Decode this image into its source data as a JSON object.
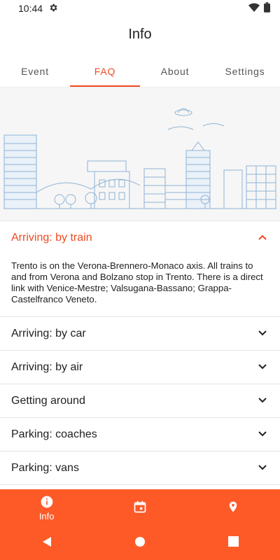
{
  "status_bar": {
    "time": "10:44",
    "icons": [
      "gear-icon",
      "wifi-icon",
      "battery-icon"
    ]
  },
  "app_title": "Info",
  "tabs": [
    {
      "label": "Event",
      "active": false
    },
    {
      "label": "FAQ",
      "active": true
    },
    {
      "label": "About",
      "active": false
    },
    {
      "label": "Settings",
      "active": false
    }
  ],
  "colors": {
    "accent": "#f04a1f",
    "bottom_nav": "#fd5a28"
  },
  "faq": {
    "items": [
      {
        "title": "Arriving: by train",
        "expanded": true,
        "body": "Trento is on the Verona-Brennero-Monaco axis. All trains to and from Verona and Bolzano stop in Trento. There is a direct link with Venice-Mestre; Valsugana-Bassano; Grappa-Castelfranco Veneto."
      },
      {
        "title": "Arriving: by car",
        "expanded": false
      },
      {
        "title": "Arriving: by air",
        "expanded": false
      },
      {
        "title": "Getting around",
        "expanded": false
      },
      {
        "title": "Parking: coaches",
        "expanded": false
      },
      {
        "title": "Parking: vans",
        "expanded": false
      }
    ]
  },
  "bottom_nav": {
    "items": [
      {
        "label": "Info",
        "icon": "info-icon",
        "active": true
      },
      {
        "label": "",
        "icon": "calendar-icon",
        "active": false
      },
      {
        "label": "",
        "icon": "map-pin-icon",
        "active": false
      }
    ]
  },
  "system_nav": [
    "back-icon",
    "home-icon",
    "recents-icon"
  ]
}
